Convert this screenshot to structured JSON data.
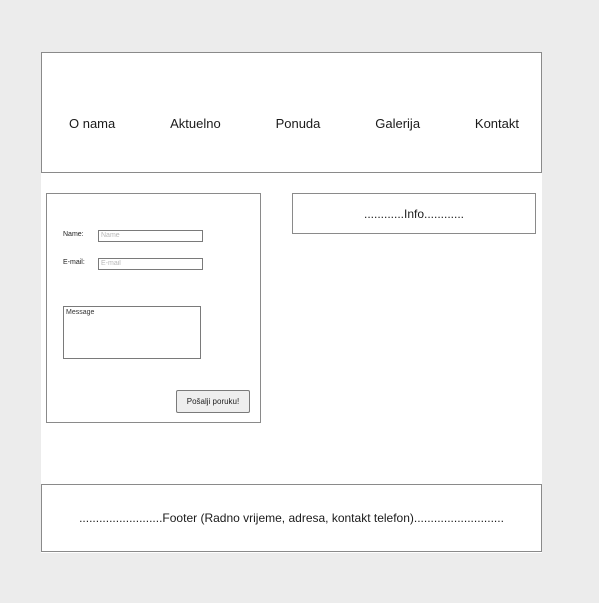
{
  "nav": {
    "items": [
      {
        "label": "O nama"
      },
      {
        "label": "Aktuelno"
      },
      {
        "label": "Ponuda"
      },
      {
        "label": "Galerija"
      },
      {
        "label": "Kontakt"
      }
    ]
  },
  "contact_form": {
    "name_label": "Name:",
    "name_placeholder": "Name",
    "email_label": "E-mail:",
    "email_placeholder": "E-mail",
    "message_placeholder": "Message",
    "submit_label": "Pošalji poruku!"
  },
  "info": {
    "text": "............Info............"
  },
  "footer": {
    "text": ".........................Footer (Radno vrijeme, adresa, kontakt telefon)..........................."
  }
}
